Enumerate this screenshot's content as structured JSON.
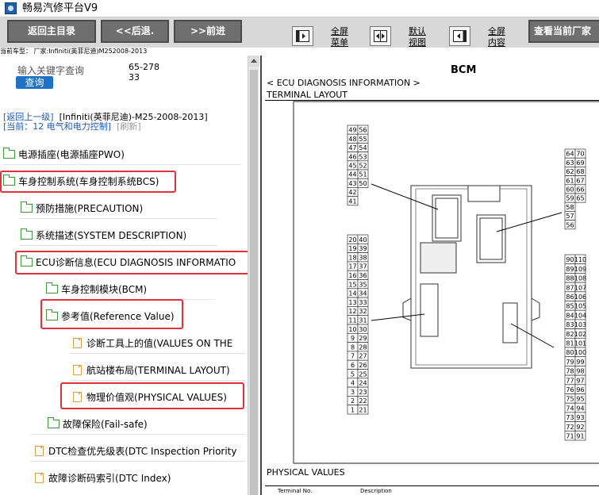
{
  "window": {
    "title": "畅易汽修平台V9",
    "icon": "app-logo-icon"
  },
  "toolbar": {
    "home_label": "返回主目录",
    "back_label": "<<后退.",
    "forward_label": ">>前进",
    "fullscreen_menu_label": "全屏菜单",
    "default_view_label": "默认视图",
    "fullscreen_content_label": "全屏内容",
    "view_label": "查看当前厂家"
  },
  "vehicle": {
    "text": "当前车型： 厂家:Infiniti(英菲尼迪)M252008-2013"
  },
  "search": {
    "label": "输入关键字查询",
    "button": "查询",
    "count": "65-27833"
  },
  "nav": {
    "up_link": "[返回上一级]",
    "path": "[Infiniti(英菲尼迪)-M25-2008-2013]",
    "current": "[当前：12 电气和电力控制]",
    "refresh": "[刷新]"
  },
  "tree": [
    {
      "label": "电源插座(电源插座PWO)",
      "icon": "folder-icon"
    },
    {
      "label": "车身控制系统(车身控制系统BCS)",
      "icon": "folder-icon"
    },
    {
      "label": "预防措施(PRECAUTION)",
      "icon": "folder-icon"
    },
    {
      "label": "系统描述(SYSTEM DESCRIPTION)",
      "icon": "folder-icon"
    },
    {
      "label": "ECU诊断信息(ECU DIAGNOSIS INFORMATIO",
      "icon": "folder-icon"
    },
    {
      "label": "车身控制模块(BCM)",
      "icon": "folder-icon"
    },
    {
      "label": "参考值(Reference Value)",
      "icon": "folder-icon"
    },
    {
      "label": "诊断工具上的值(VALUES ON THE",
      "icon": "document-icon"
    },
    {
      "label": "航站楼布局(TERMINAL LAYOUT)",
      "icon": "document-icon"
    },
    {
      "label": "物理价值观(PHYSICAL VALUES)",
      "icon": "document-icon"
    },
    {
      "label": "故障保险(Fail-safe)",
      "icon": "folder-icon"
    },
    {
      "label": "DTC检查优先级表(DTC Inspection Priority",
      "icon": "document-icon"
    },
    {
      "label": "故障诊断码索引(DTC Index)",
      "icon": "document-icon"
    }
  ],
  "document": {
    "heading": "BCM",
    "section": "< ECU DIAGNOSIS INFORMATION >",
    "subheading": "TERMINAL LAYOUT",
    "connector_1_rows": [
      [
        "49",
        "56"
      ],
      [
        "48",
        "55"
      ],
      [
        "47",
        "54"
      ],
      [
        "46",
        "53"
      ],
      [
        "45",
        "52"
      ],
      [
        "44",
        "51"
      ],
      [
        "43",
        "50"
      ],
      [
        "42",
        ""
      ],
      [
        "41",
        ""
      ]
    ],
    "connector_2_rows": [
      [
        "64",
        "70"
      ],
      [
        "63",
        "69"
      ],
      [
        "62",
        "68"
      ],
      [
        "61",
        "67"
      ],
      [
        "60",
        "66"
      ],
      [
        "59",
        "65"
      ],
      [
        "58",
        ""
      ],
      [
        "57",
        ""
      ],
      [
        "56",
        ""
      ]
    ],
    "connector_3_rows": [
      [
        "20",
        "40"
      ],
      [
        "19",
        "39"
      ],
      [
        "18",
        "38"
      ],
      [
        "17",
        "37"
      ],
      [
        "16",
        "36"
      ],
      [
        "15",
        "35"
      ],
      [
        "14",
        "34"
      ],
      [
        "13",
        "33"
      ],
      [
        "12",
        "32"
      ],
      [
        "11",
        "31"
      ],
      [
        "10",
        "30"
      ],
      [
        "9",
        "29"
      ],
      [
        "8",
        "28"
      ],
      [
        "7",
        "27"
      ],
      [
        "6",
        "26"
      ],
      [
        "5",
        "25"
      ],
      [
        "4",
        "24"
      ],
      [
        "3",
        "23"
      ],
      [
        "2",
        "22"
      ],
      [
        "1",
        "21"
      ]
    ],
    "connector_4_rows": [
      [
        "90",
        "110"
      ],
      [
        "89",
        "109"
      ],
      [
        "88",
        "108"
      ],
      [
        "87",
        "107"
      ],
      [
        "86",
        "106"
      ],
      [
        "85",
        "105"
      ],
      [
        "84",
        "104"
      ],
      [
        "83",
        "103"
      ],
      [
        "82",
        "102"
      ],
      [
        "81",
        "101"
      ],
      [
        "80",
        "100"
      ],
      [
        "79",
        "99"
      ],
      [
        "78",
        "98"
      ],
      [
        "77",
        "97"
      ],
      [
        "76",
        "96"
      ],
      [
        "75",
        "95"
      ],
      [
        "74",
        "94"
      ],
      [
        "73",
        "93"
      ],
      [
        "72",
        "92"
      ],
      [
        "71",
        "91"
      ]
    ],
    "physical_values_title": "PHYSICAL VALUES",
    "table_headers": [
      "Terminal No.",
      "Description"
    ]
  },
  "colors": {
    "highlight": "#e0323e",
    "link": "#1e5ab0",
    "button": "#6f6f6f",
    "search": "#1f72c4",
    "folder": "#3c9a3c",
    "doc": "#d9a24b"
  }
}
